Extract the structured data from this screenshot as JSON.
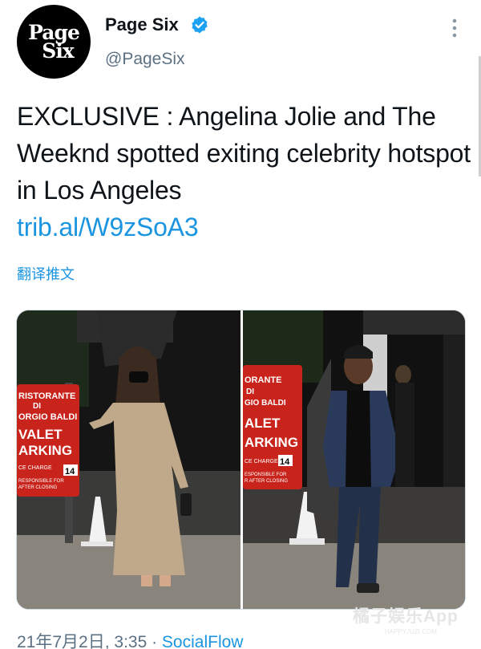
{
  "account": {
    "name": "Page Six",
    "handle": "@PageSix",
    "avatar_lines": [
      "Page",
      "Six"
    ],
    "verified": true
  },
  "tweet": {
    "text": "EXCLUSIVE : Angelina Jolie and The Weeknd spotted exiting celebrity hotspot in Los Angeles",
    "link": "trib.al/W9zSoA3",
    "translate": "翻译推文"
  },
  "photos": {
    "left_signs": [
      "RISTORANTE",
      "DI",
      "ORGIO BALDI",
      "VALET",
      "ARKING",
      "CE CHARGE",
      "14",
      "RESPONSIBLE FOR",
      "AFTER CLOSING"
    ],
    "right_signs": [
      "ORANTE",
      "DI",
      "GIO BALDI",
      "ALET",
      "ARKING",
      "CE CHARGE",
      "14",
      "ESPONSIBLE FOR",
      "R AFTER CLOSING"
    ]
  },
  "footer": {
    "date": "21年7月2日, 3:35 · ",
    "source": "SocialFlow"
  },
  "watermark": {
    "main": "橘子娱乐App",
    "sub": "HAPPYJUZI.COM"
  },
  "colors": {
    "link": "#1b95e0",
    "secondary": "#5b7083",
    "verified": "#1da1f2",
    "text": "#0f1419"
  }
}
